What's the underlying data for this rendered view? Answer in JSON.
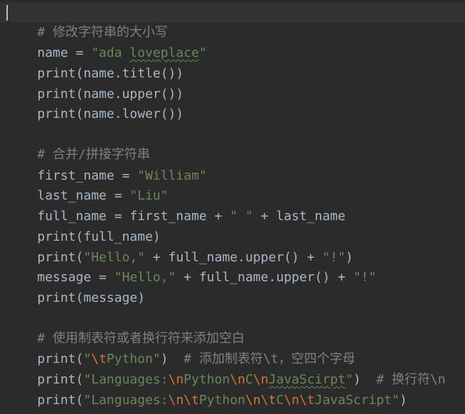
{
  "editor": {
    "lines": [
      {
        "parts": [
          "# 修改字符串的大小写"
        ]
      },
      {
        "parts": [
          "name = ",
          "\"ada ",
          "loveplace",
          "\""
        ]
      },
      {
        "parts": [
          "print(name.title())"
        ]
      },
      {
        "parts": [
          "print(name.upper())"
        ]
      },
      {
        "parts": [
          "print(name.lower())"
        ]
      },
      {
        "parts": [
          "# 合并/拼接字符串"
        ]
      },
      {
        "parts": [
          "first_name = ",
          "\"William\""
        ]
      },
      {
        "parts": [
          "last_name = ",
          "\"Liu\""
        ]
      },
      {
        "parts": [
          "full_name = first_name + ",
          "\" \"",
          " + last_name"
        ]
      },
      {
        "parts": [
          "print(full_name)"
        ]
      },
      {
        "parts": [
          "print(",
          "\"Hello,\"",
          " + full_name.upper() + ",
          "\"!\"",
          ")"
        ]
      },
      {
        "parts": [
          "message = ",
          "\"Hello,\"",
          " + full_name.upper() + ",
          "\"!\""
        ]
      },
      {
        "parts": [
          "print(message)"
        ]
      },
      {
        "parts": [
          "# 使用制表符或者换行符来添加空白"
        ]
      },
      {
        "parts": [
          "print(",
          "\"",
          "\\t",
          "Python\"",
          ")  ",
          "# 添加制表符\\t，空四个字母"
        ]
      },
      {
        "parts": [
          "print(",
          "\"Languages:",
          "\\n",
          "Python",
          "\\n",
          "C",
          "\\n",
          "JavaScirpt",
          "\"",
          ")  ",
          "# 换行符\\n"
        ]
      },
      {
        "parts": [
          "print(",
          "\"Languages:",
          "\\n",
          "\\t",
          "Python",
          "\\n",
          "\\t",
          "C",
          "\\n",
          "\\t",
          "JavaScript\"",
          ")"
        ]
      }
    ]
  }
}
